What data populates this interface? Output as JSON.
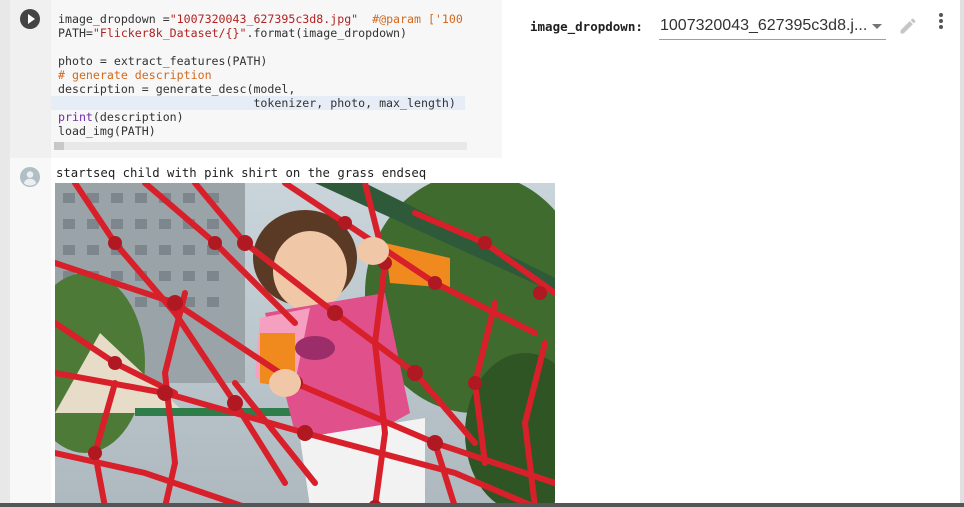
{
  "code_cell": {
    "code_lines": [
      "image_dropdown =\"1007320043_627395c3d8.jpg\"  #@param ['100",
      "PATH=\"Flicker8k_Dataset/{}\".format(image_dropdown)",
      "",
      "photo = extract_features(PATH)",
      "# generate description",
      "description = generate_desc(model,",
      "                            tokenizer, photo, max_length)",
      "print(description)",
      "load_img(PATH)"
    ]
  },
  "form": {
    "label": "image_dropdown:",
    "selected_value": "1007320043_627395c3d8.j..."
  },
  "output": {
    "text": "startseq child with pink shirt on the grass endseq"
  },
  "icons": {
    "run": "play-icon",
    "edit": "pencil-icon",
    "more": "more-vert-icon",
    "output": "person-icon"
  },
  "colors": {
    "string": "#b22222",
    "comment": "#d2691e",
    "builtin": "#6f2da8",
    "net_red": "#d8202a",
    "shirt_pink": "#e0508a"
  }
}
